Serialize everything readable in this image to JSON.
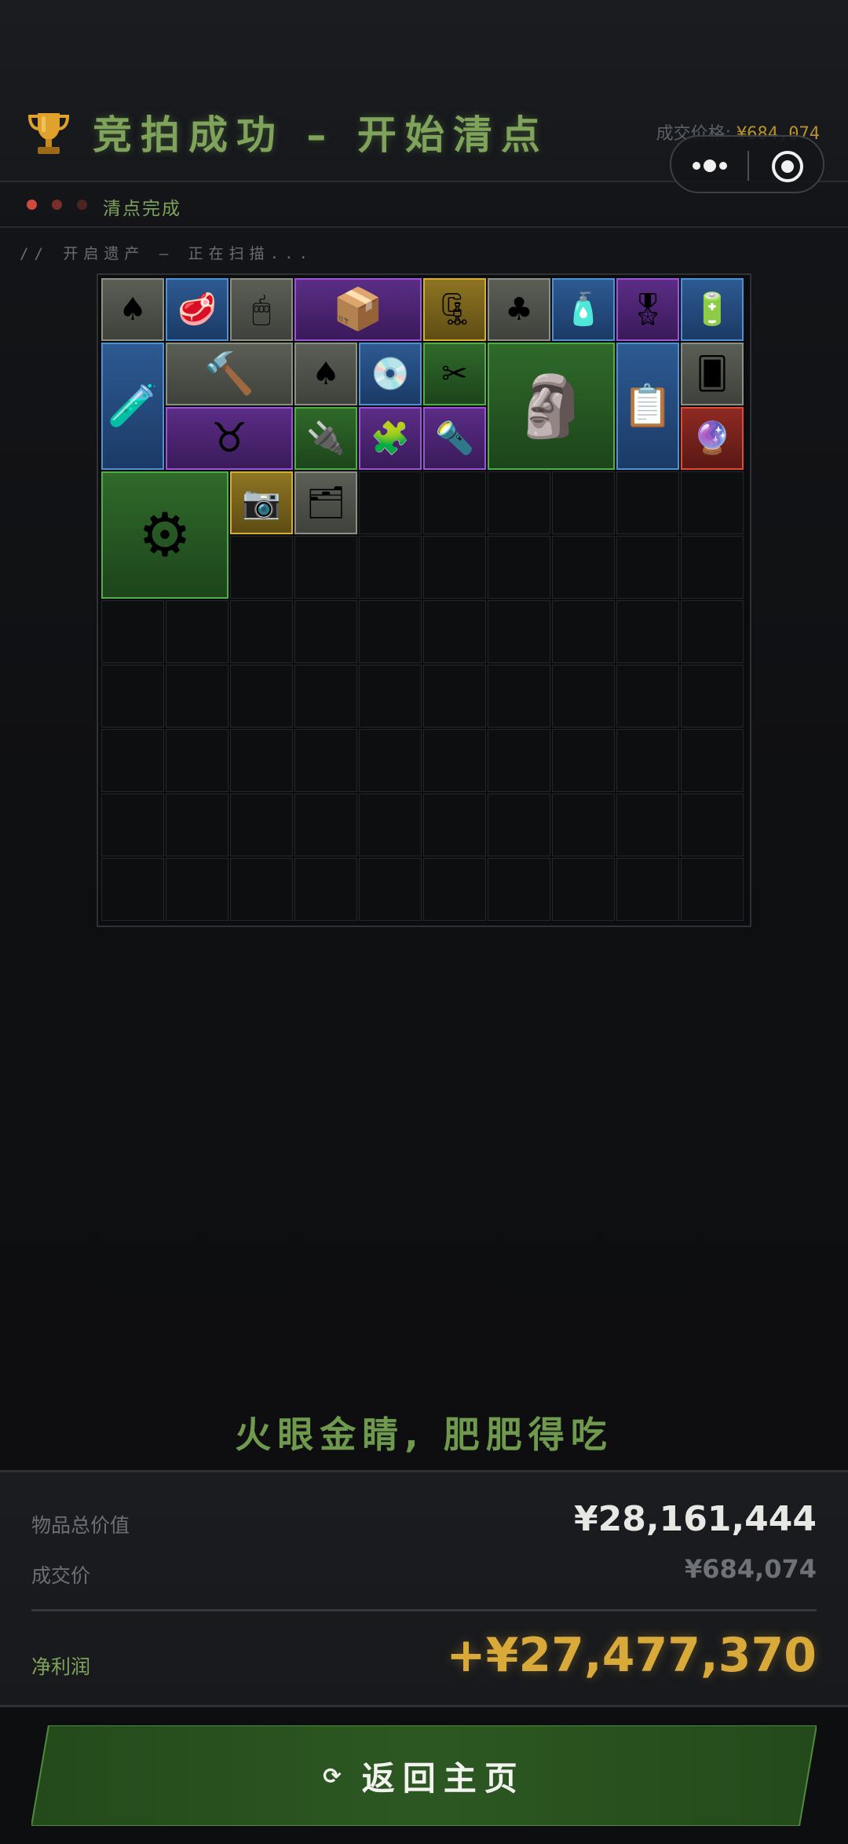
{
  "header": {
    "title": "竞拍成功 – 开始清点",
    "price_label": "成交价格:",
    "price_value": "¥684,074",
    "trophy_icon": "trophy-icon"
  },
  "capsule": {
    "more_icon": "more-dots-icon",
    "target_icon": "target-icon"
  },
  "progress": {
    "label": "清点完成"
  },
  "scan_status": "// 开启遗产 – 正在扫描...",
  "inventory": {
    "columns": 10,
    "rows": 10,
    "items": [
      {
        "name": "playing-card",
        "icon": "♠",
        "quality": "gray"
      },
      {
        "name": "food-pack",
        "icon": "🥩",
        "quality": "blue"
      },
      {
        "name": "computer-mouse",
        "icon": "🖱",
        "quality": "gray"
      },
      {
        "name": "boxed-device",
        "icon": "📦",
        "quality": "purple"
      },
      {
        "name": "vise-clamp",
        "icon": "🗜",
        "quality": "yellow"
      },
      {
        "name": "playing-card",
        "icon": "♣",
        "quality": "gray"
      },
      {
        "name": "fuel-canister",
        "icon": "🧴",
        "quality": "blue"
      },
      {
        "name": "military-badge",
        "icon": "🎖",
        "quality": "purple"
      },
      {
        "name": "power-bank",
        "icon": "🔋",
        "quality": "blue"
      },
      {
        "name": "chemical-bottle",
        "icon": "🧪",
        "quality": "blue"
      },
      {
        "name": "hammer",
        "icon": "🔨",
        "quality": "gray"
      },
      {
        "name": "playing-card",
        "icon": "♠",
        "quality": "gray"
      },
      {
        "name": "cd-disc",
        "icon": "💿",
        "quality": "blue"
      },
      {
        "name": "scissors",
        "icon": "✂",
        "quality": "green"
      },
      {
        "name": "winged-statue",
        "icon": "🗿",
        "quality": "green"
      },
      {
        "name": "clipboard",
        "icon": "📋",
        "quality": "blue"
      },
      {
        "name": "playing-card",
        "icon": "🂠",
        "quality": "gray"
      },
      {
        "name": "horned-necklace",
        "icon": "♉",
        "quality": "purple"
      },
      {
        "name": "power-strip",
        "icon": "🔌",
        "quality": "green"
      },
      {
        "name": "circuit-board",
        "icon": "🧩",
        "quality": "purple"
      },
      {
        "name": "flashlight",
        "icon": "🔦",
        "quality": "purple"
      },
      {
        "name": "glass-orb",
        "icon": "🔮",
        "quality": "red"
      },
      {
        "name": "power-supply",
        "icon": "⚙",
        "quality": "green"
      },
      {
        "name": "camera-lens",
        "icon": "📷",
        "quality": "yellow"
      },
      {
        "name": "matchbox",
        "icon": "🗂",
        "quality": "gray"
      }
    ]
  },
  "slogan": "火眼金睛, 肥肥得吃",
  "summary": {
    "total_label": "物品总价值",
    "total_value": "¥28,161,444",
    "deal_label": "成交价",
    "deal_value": "¥684,074",
    "profit_label": "净利润",
    "profit_value": "+¥27,477,370"
  },
  "return_button": {
    "label": "返回主页",
    "icon": "refresh-icon"
  },
  "colors": {
    "accent_green": "#7fa35a",
    "gold": "#d9a93a",
    "gray": "#8c8f84",
    "blue": "#4f8fd4",
    "purple": "#9a55d6",
    "yellow": "#d4ad33",
    "green": "#4fae47",
    "red": "#e04a3a"
  }
}
